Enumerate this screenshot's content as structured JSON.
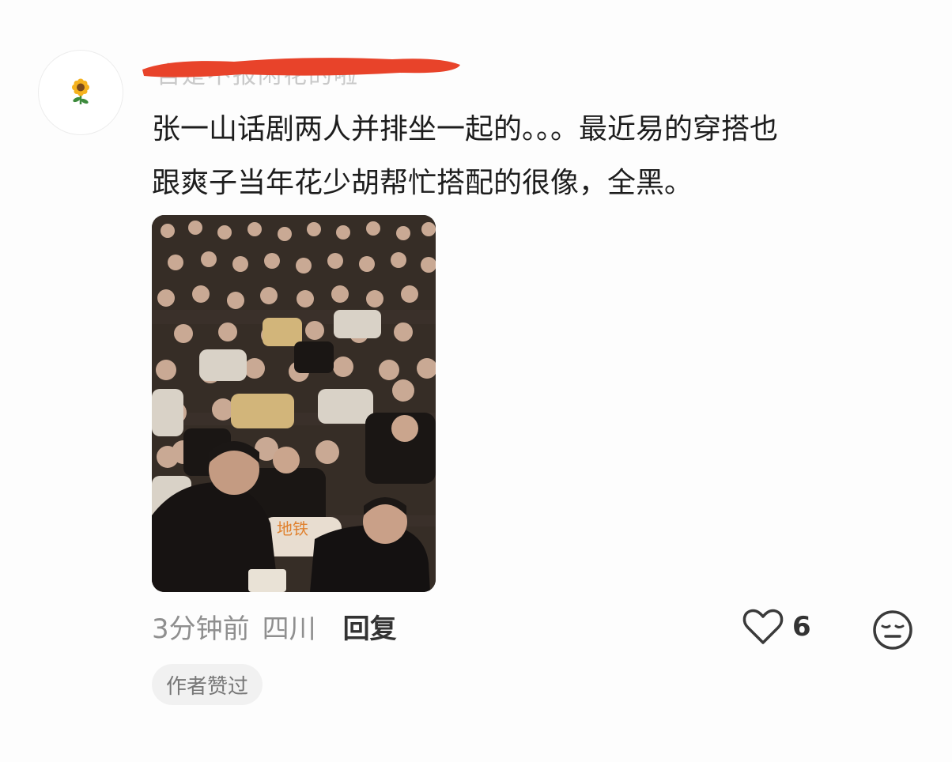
{
  "comment": {
    "username": "自是不报闲花的啦",
    "avatar_icon": "sunflower-icon",
    "text_line1": "张一山话剧两人并排坐一起的。。。最近易的穿搭也",
    "text_line2": "跟爽子当年花少胡帮忙搭配的很像，全黑。",
    "photo_sign_text": "地铁",
    "time": "3分钟前",
    "location": "四川",
    "reply_label": "回复",
    "like_icon": "heart-outline-icon",
    "like_count": "6",
    "dislike_icon": "meh-face-icon",
    "badge": "作者赞过"
  },
  "colors": {
    "text": "#1d1d1d",
    "meta": "#8f8f8f",
    "redaction": "#e8432a",
    "badge_bg": "#f1f1f1"
  }
}
